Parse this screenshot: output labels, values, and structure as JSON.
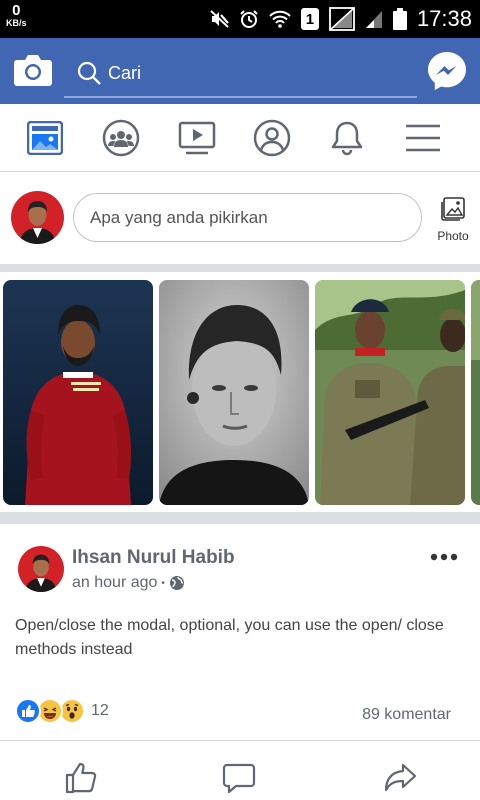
{
  "status_bar": {
    "speed_value": "0",
    "speed_unit": "KB/s",
    "sim_badge": "1",
    "time": "17:38",
    "icons": [
      "mute-icon",
      "alarm-icon",
      "wifi-icon",
      "sim-badge",
      "no-signal-icon",
      "signal-icon",
      "battery-icon"
    ]
  },
  "top_bar": {
    "search_placeholder": "Cari",
    "color": "#4267b2",
    "icons": [
      "camera-icon",
      "search-icon",
      "messenger-icon"
    ]
  },
  "nav": {
    "tabs": [
      {
        "name": "news-feed",
        "icon": "news-feed-icon",
        "active": true
      },
      {
        "name": "groups",
        "icon": "groups-icon",
        "active": false
      },
      {
        "name": "watch",
        "icon": "video-icon",
        "active": false
      },
      {
        "name": "profile",
        "icon": "profile-icon",
        "active": false
      },
      {
        "name": "notifications",
        "icon": "bell-icon",
        "active": false
      },
      {
        "name": "menu",
        "icon": "hamburger-icon",
        "active": false
      }
    ],
    "accent": "#4267b2"
  },
  "composer": {
    "placeholder": "Apa yang anda pikirkan",
    "photo_label": "Photo"
  },
  "stories": [
    {
      "name": "story-footballer"
    },
    {
      "name": "story-portrait-bw"
    },
    {
      "name": "story-soldiers"
    },
    {
      "name": "story-partial"
    }
  ],
  "post": {
    "author": "Ihsan Nurul Habib",
    "time": "an hour ago",
    "separator": "•",
    "text": "Open/close the modal, optional, you can use the open/ close methods instead",
    "reaction_count": "12",
    "comment_count": "89 komentar",
    "reactions": [
      "like-icon",
      "haha-icon",
      "wow-icon"
    ]
  },
  "actions": [
    "like-action-icon",
    "comment-action-icon",
    "share-action-icon"
  ]
}
